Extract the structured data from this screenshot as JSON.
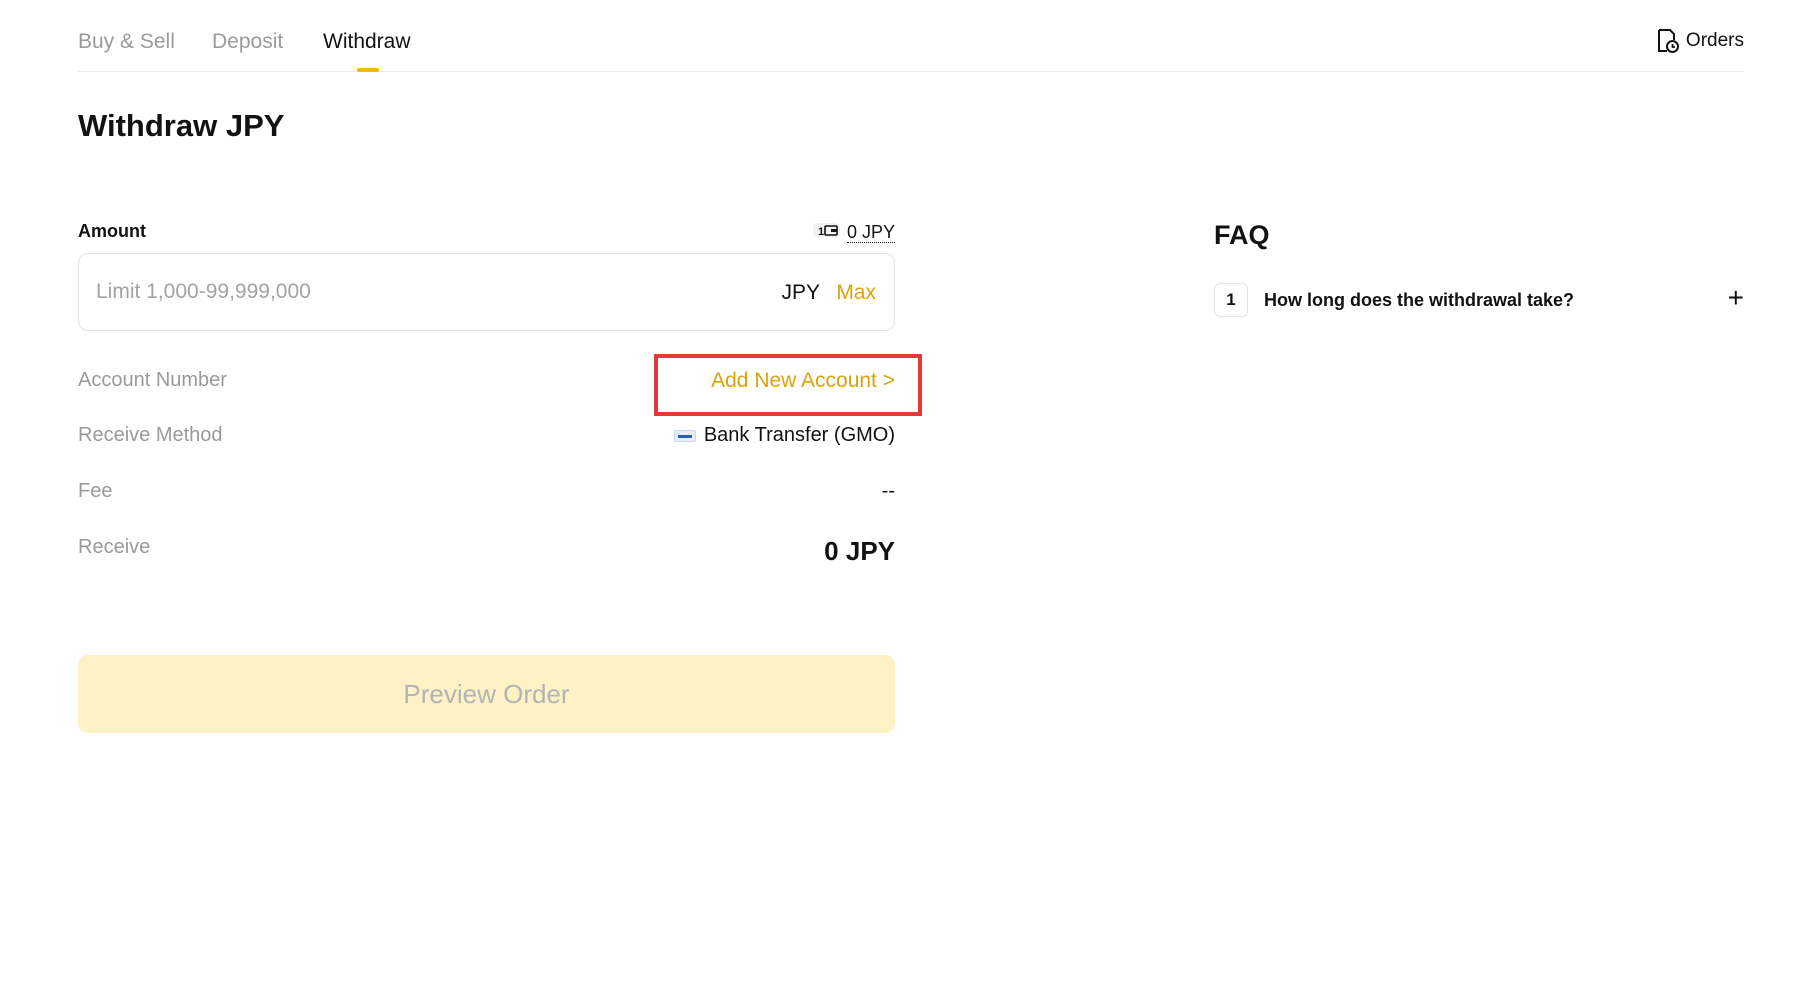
{
  "tabs": [
    {
      "label": "Buy & Sell",
      "active": false
    },
    {
      "label": "Deposit",
      "active": false
    },
    {
      "label": "Withdraw",
      "active": true
    }
  ],
  "orders_label": "Orders",
  "page_title": "Withdraw JPY",
  "amount": {
    "label": "Amount",
    "balance": "0 JPY",
    "placeholder": "Limit 1,000-99,999,000",
    "value": "",
    "unit": "JPY",
    "max_label": "Max"
  },
  "details": {
    "account_number": {
      "label": "Account Number",
      "action": "Add New Account >"
    },
    "receive_method": {
      "label": "Receive Method",
      "value": "Bank Transfer (GMO)",
      "icon": "bank-logo-icon"
    },
    "fee": {
      "label": "Fee",
      "value": "--"
    },
    "receive": {
      "label": "Receive",
      "value": "0 JPY"
    }
  },
  "preview_button": "Preview Order",
  "faq": {
    "title": "FAQ",
    "items": [
      {
        "number": "1",
        "question": "How long does the withdrawal take?"
      }
    ]
  },
  "colors": {
    "accent": "#f0b90b",
    "link": "#d9a40a",
    "highlight_box": "#e53935",
    "button_disabled_bg": "#fdf1c6"
  }
}
